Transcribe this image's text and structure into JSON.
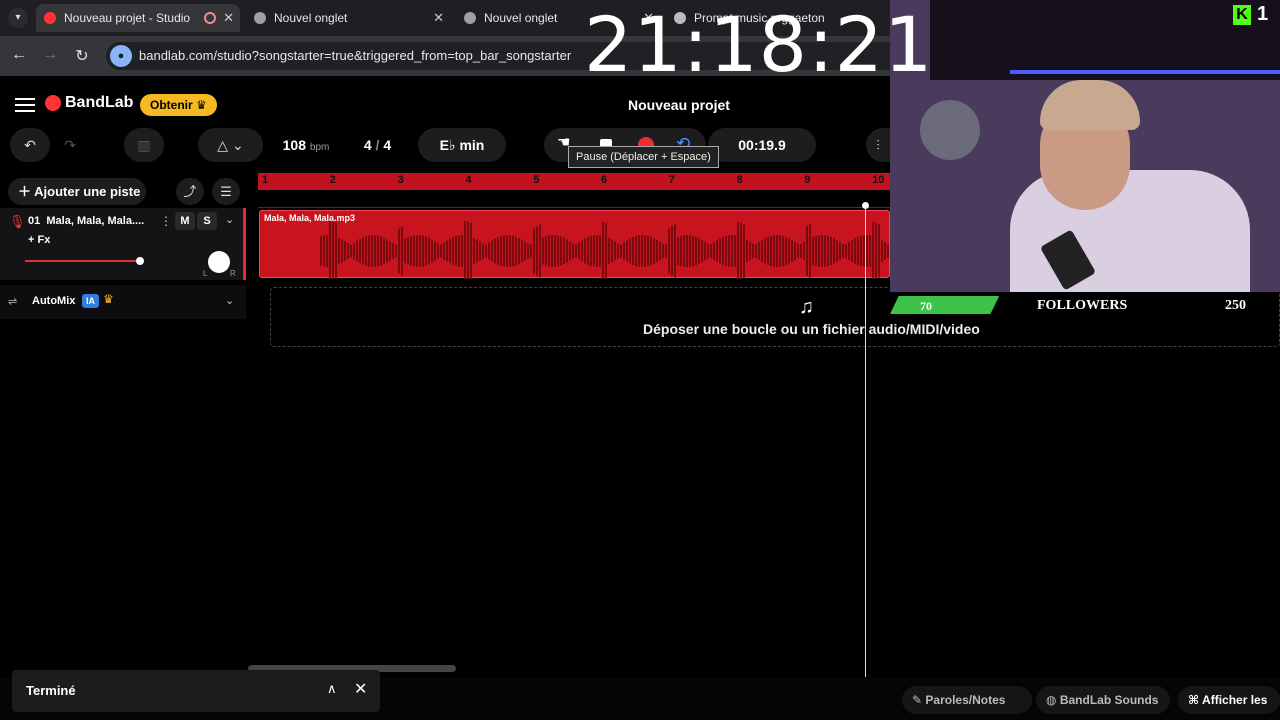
{
  "browser": {
    "tabs": [
      {
        "title": "Nouveau projet - Studio",
        "active": true,
        "recording": true
      },
      {
        "title": "Nouvel onglet",
        "active": false
      },
      {
        "title": "Nouvel onglet",
        "active": false
      },
      {
        "title": "Prompt music reggaeton",
        "active": false
      }
    ],
    "url": "bandlab.com/studio?songstarter=true&triggered_from=top_bar_songstarter"
  },
  "overlay": {
    "clock": "21:18:21",
    "kick_count": "1",
    "followers": {
      "label": "FOLLOWERS",
      "current": "70",
      "target": "250",
      "progress": 0.28
    }
  },
  "app": {
    "logo": "BandLab",
    "get_button": "Obtenir",
    "project_title": "Nouveau projet",
    "toolbar": {
      "tempo": "108",
      "tempo_unit": "bpm",
      "time_sig_num": "4",
      "time_sig_den": "4",
      "key": "E♭ min",
      "time": "00:19.9",
      "tooltip": "Pause (Déplacer + Espace)"
    },
    "add_track": "Ajouter une piste",
    "track": {
      "number": "01",
      "name": "Mala, Mala, Mala....",
      "mute": "M",
      "solo": "S",
      "fx": "+ Fx",
      "pan_left": "L",
      "pan_right": "R",
      "volume": 0.9,
      "region_name": "Mala, Mala, Mala.mp3"
    },
    "automix": {
      "label": "AutoMix",
      "badge": "IA"
    },
    "ruler": [
      "1",
      "2",
      "3",
      "4",
      "5",
      "6",
      "7",
      "8",
      "9",
      "10"
    ],
    "dropzone": "Déposer une boucle ou un fichier audio/MIDI/video",
    "footer": {
      "toast": "Terminé",
      "lyrics": "Paroles/Notes",
      "sounds": "BandLab Sounds",
      "shortcuts": "Afficher les"
    }
  }
}
